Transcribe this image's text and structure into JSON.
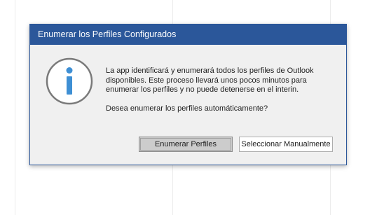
{
  "dialog": {
    "title": "Enumerar los Perfiles Configurados",
    "message": "La app identificará y enumerará todos los perfiles de Outlook disponibles. Este proceso llevará unos pocos minutos para enumerar los perfiles y no puede detenerse en el interin.",
    "question": "Desea enumerar los perfiles automáticamente?",
    "icon": "info-icon",
    "buttons": {
      "primary_label": "Enumerar Perfiles",
      "secondary_label": "Seleccionar Manualmente"
    }
  },
  "colors": {
    "titlebar": "#2b579a",
    "icon_accent": "#3e8fd4",
    "icon_ring": "#7a7a7a"
  }
}
